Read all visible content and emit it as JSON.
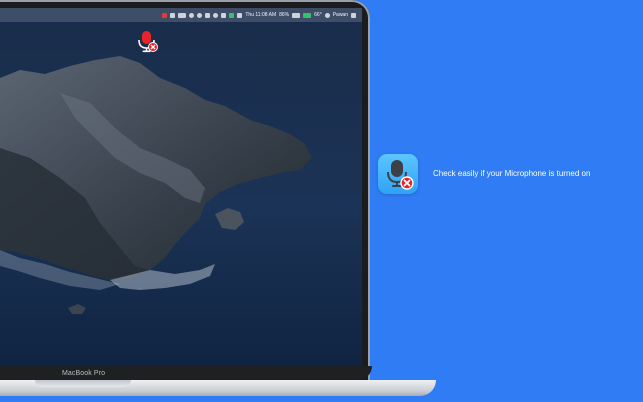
{
  "menubar": {
    "datetime": "Thu 11:08 AM",
    "battery": "86%",
    "temperature": "66°",
    "user": "Pawan",
    "icons": [
      "mic-off-icon",
      "screen-icon",
      "window-icon",
      "at-icon",
      "gear-icon",
      "grid-icon",
      "clock-icon",
      "bluetooth-icon",
      "volume-icon",
      "wifi-icon",
      "battery-icon",
      "search-icon",
      "control-center-icon"
    ]
  },
  "laptop": {
    "model_label": "MacBook Pro"
  },
  "promo": {
    "app_icon": "microphone-muted-icon",
    "tagline": "Check easily if your Microphone is turned on"
  },
  "colors": {
    "background": "#2f7cf4",
    "icon_gradient_top": "#5cc6ff",
    "muted_badge": "#e8242b",
    "indicator_red": "#e8242b"
  }
}
